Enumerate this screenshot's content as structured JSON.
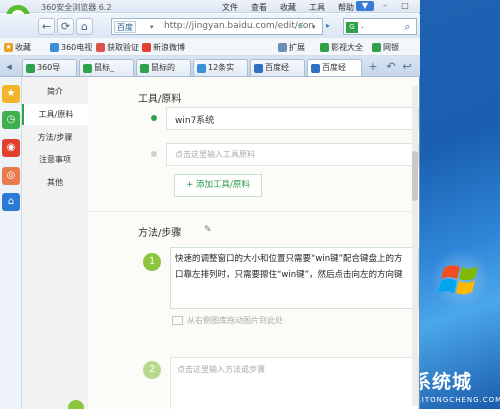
{
  "app": {
    "title": "360安全浏览器 6.2",
    "menu": [
      "文件",
      "查看",
      "收藏",
      "工具",
      "帮助"
    ],
    "window_buttons": [
      "▼",
      "–",
      "□"
    ]
  },
  "nav": {
    "back": "←",
    "forward": "→",
    "refresh": "⟳",
    "home": "⌂",
    "site_chip": "百度",
    "url": "http://jingyan.baidu.com/edit/con",
    "search_placeholder": "."
  },
  "bookmarks": {
    "left": [
      {
        "label": "收藏",
        "color": "#e8a21a"
      },
      {
        "label": "360电视",
        "color": "#3b8fd8"
      },
      {
        "label": "获取验证",
        "color": "#d9534f"
      },
      {
        "label": "新浪微博",
        "color": "#e0402d"
      }
    ],
    "right": [
      {
        "label": "扩展",
        "color": "#6b8fb5"
      },
      {
        "label": "影视大全",
        "color": "#2ea14a"
      },
      {
        "label": "网银",
        "color": "#2ea14a"
      }
    ]
  },
  "tabs": [
    {
      "label": "360导",
      "color": "#2ea14a"
    },
    {
      "label": "鼠标_",
      "color": "#2ea14a"
    },
    {
      "label": "鼠标的",
      "color": "#2ea14a"
    },
    {
      "label": "12条实",
      "color": "#3b8fd8"
    },
    {
      "label": "百度经",
      "color": "#2d6fc4"
    },
    {
      "label": "百度经",
      "color": "#2d6fc4"
    }
  ],
  "left_nav": {
    "items": [
      "简介",
      "工具/原料",
      "方法/步骤",
      "注意事项",
      "其他"
    ]
  },
  "tools_section": {
    "heading": "工具/原料",
    "item_value": "win7系统",
    "item_placeholder": "点击这里输入工具原料",
    "add_button": "+ 添加工具/原料"
  },
  "steps_section": {
    "heading": "方法/步骤",
    "step1_number": "1",
    "step1_line1": "快速的调整窗口的大小和位置只需要“win键”配合键盘上的方",
    "step1_line2": "口靠左排列时，只需要摁住“win键”，然后点击向左的方向键",
    "image_hint": "从右侧图库拖动图片到此处",
    "step2_number": "2",
    "step2_placeholder": "点击这里输入方法或步骤"
  },
  "watermark": {
    "title": "系统城",
    "subtitle": "XITONGCHENG.COM"
  },
  "colors": {
    "accent_green": "#2ea14a",
    "step_green": "#8cc63f",
    "desktop_blue": "#1f62b3"
  }
}
